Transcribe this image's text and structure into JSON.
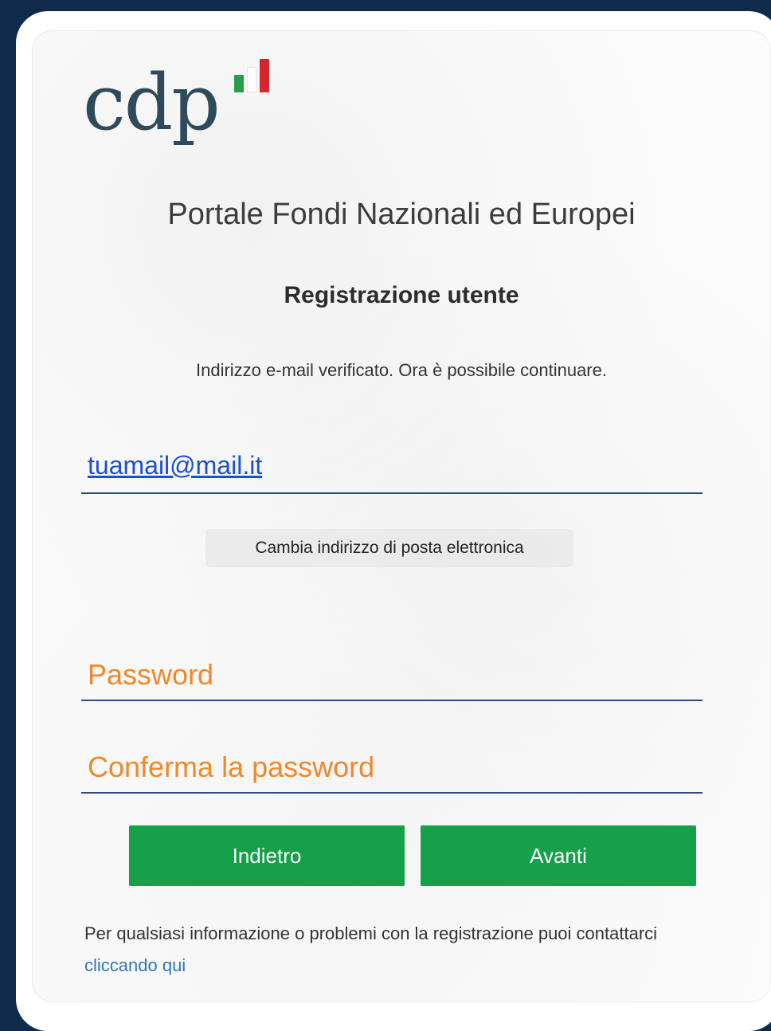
{
  "logo": {
    "text": "cdp"
  },
  "page": {
    "title": "Portale Fondi Nazionali ed Europei",
    "subtitle": "Registrazione utente",
    "info": "Indirizzo e-mail verificato. Ora è possibile continuare."
  },
  "email": {
    "value": "tuamail@mail.it",
    "change_label": "Cambia indirizzo di posta elettronica"
  },
  "form": {
    "password_label": "Password",
    "confirm_password_label": "Conferma la password"
  },
  "buttons": {
    "back_label": "Indietro",
    "next_label": "Avanti"
  },
  "footer": {
    "text": "Per qualsiasi informazione o problemi con la registrazione puoi contattarci ",
    "link_text": "cliccando qui"
  },
  "colors": {
    "background": "#0f2a4a",
    "button_green": "#16a049",
    "label_orange": "#f0882a",
    "link_blue": "#1a4fd6"
  }
}
